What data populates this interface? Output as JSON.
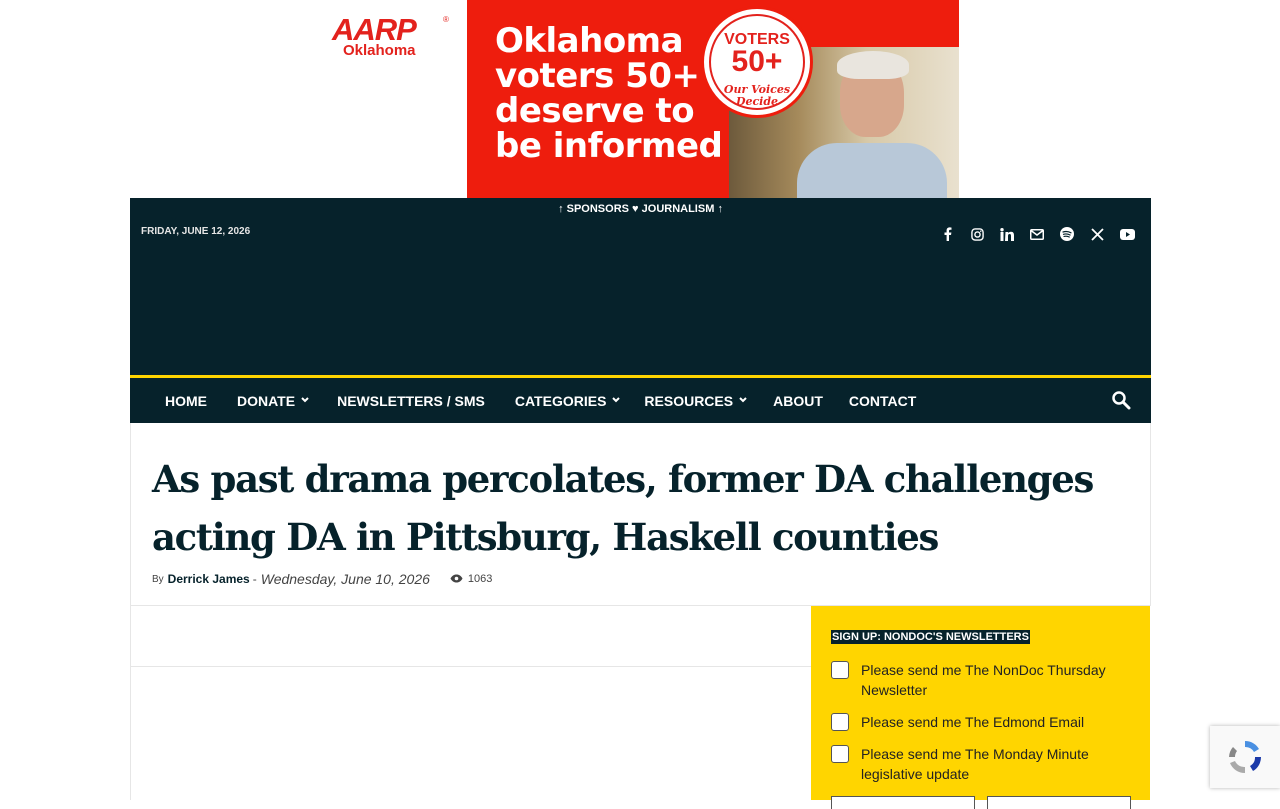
{
  "ad": {
    "brand": "AARP",
    "brand_state": "Oklahoma",
    "headline": "Oklahoma voters 50+ deserve to be informed",
    "badge_line1": "VOTERS",
    "badge_line2": "50+",
    "badge_line3": "Our Voices Decide",
    "colors": {
      "banner": "#ee1d0d",
      "brand": "#e3221d"
    }
  },
  "header": {
    "sponsor_line": "SPONSORS",
    "sponsor_line2": "JOURNALISM",
    "date": "FRIDAY, JUNE 12, 2026",
    "social_icons": [
      "facebook-icon",
      "instagram-icon",
      "linkedin-icon",
      "mail-icon",
      "spotify-icon",
      "x-icon",
      "youtube-icon"
    ],
    "colors": {
      "bg": "#06222b",
      "accent": "#ffd500"
    }
  },
  "nav": {
    "items": [
      {
        "label": "HOME",
        "dropdown": false
      },
      {
        "label": "DONATE",
        "dropdown": true
      },
      {
        "label": "NEWSLETTERS / SMS",
        "dropdown": false
      },
      {
        "label": "CATEGORIES",
        "dropdown": true
      },
      {
        "label": "RESOURCES",
        "dropdown": true
      },
      {
        "label": "ABOUT",
        "dropdown": false
      },
      {
        "label": "CONTACT",
        "dropdown": false
      }
    ],
    "search_icon": "search-icon"
  },
  "article": {
    "title": "As past drama percolates, former DA challenges acting DA in Pittsburg, Haskell counties",
    "by": "By",
    "author": "Derrick James",
    "separator": "-",
    "date": "Wednesday, June 10, 2026",
    "views": "1063"
  },
  "newsletter": {
    "title": "SIGN UP: NONDOC'S NEWSLETTERS",
    "options": [
      "Please send me The NonDoc Thursday Newsletter",
      "Please send me The Edmond Email",
      "Please send me The Monday Minute legislative update"
    ]
  }
}
